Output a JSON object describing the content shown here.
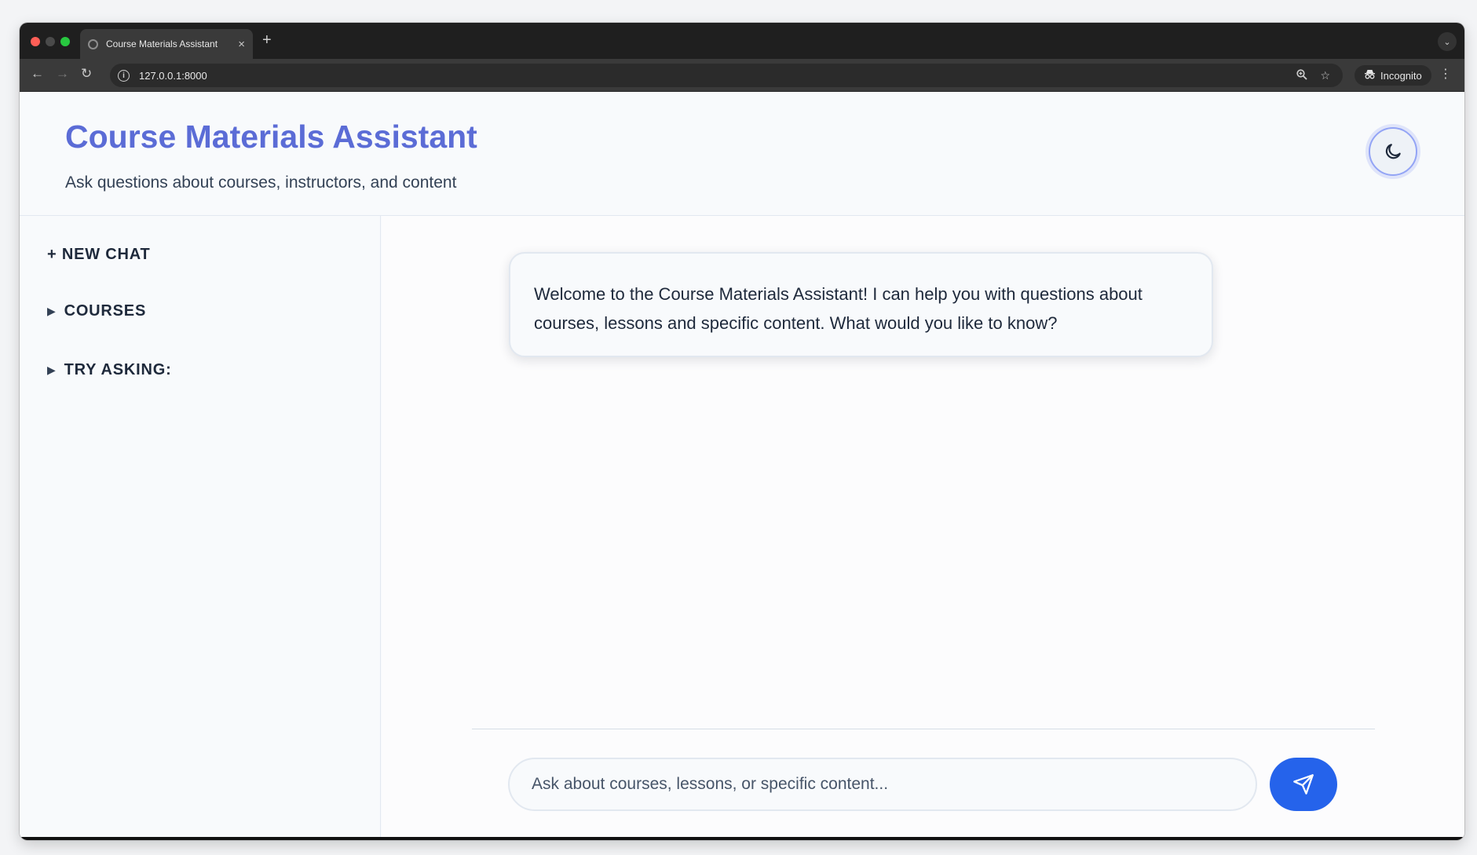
{
  "browser": {
    "tab_title": "Course Materials Assistant",
    "tab_close": "×",
    "new_tab": "+",
    "url": "127.0.0.1:8000",
    "incognito_label": "Incognito",
    "icons": [
      "back-icon",
      "forward-icon",
      "reload-icon",
      "info-icon",
      "zoom-icon",
      "bookmark-star-icon",
      "incognito-icon",
      "kebab-menu-icon",
      "tab-list-icon"
    ]
  },
  "header": {
    "title": "Course Materials Assistant",
    "subtitle": "Ask questions about courses, instructors, and content",
    "theme_toggle_icon": "moon-icon"
  },
  "sidebar": {
    "new_chat": "+ NEW CHAT",
    "courses": "COURSES",
    "try_asking": "TRY ASKING:",
    "caret": "▶"
  },
  "chat": {
    "welcome_message": "Welcome to the Course Materials Assistant! I can help you with questions about courses, lessons and specific content. What would you like to know?",
    "input_placeholder": "Ask about courses, lessons, or specific content...",
    "send_icon": "send-icon"
  },
  "colors": {
    "accent": "#5b6cd6",
    "send_button": "#2563eb",
    "text": "#1e293b"
  }
}
